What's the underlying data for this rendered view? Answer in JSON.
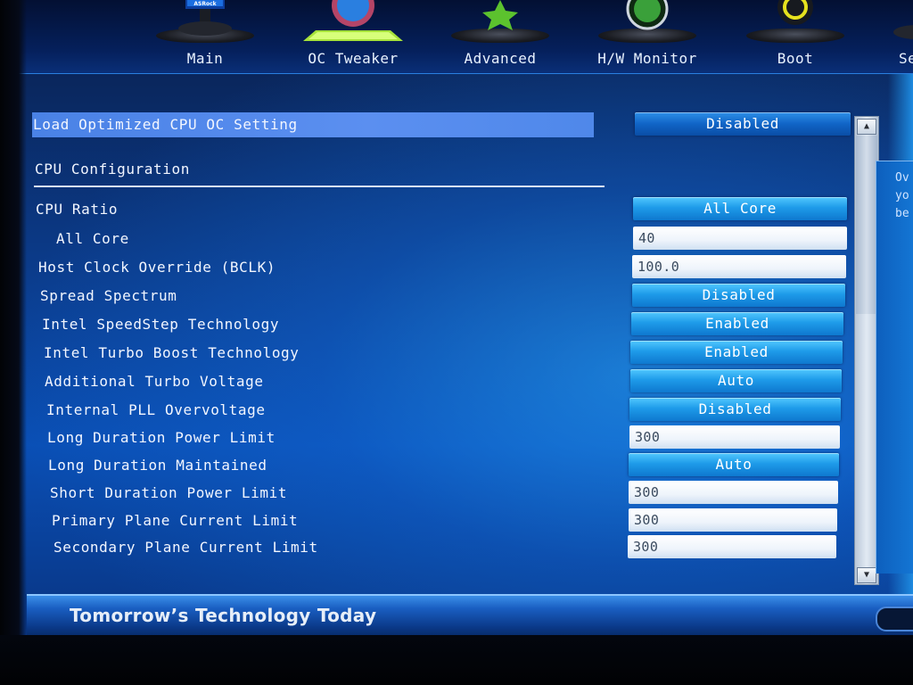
{
  "nav": {
    "tabs": [
      {
        "label": "Main",
        "icon": "monitor-icon",
        "brand_text": "ASRock"
      },
      {
        "label": "OC Tweaker",
        "icon": "gauge-icon"
      },
      {
        "label": "Advanced",
        "icon": "star-icon"
      },
      {
        "label": "H/W Monitor",
        "icon": "radar-icon"
      },
      {
        "label": "Boot",
        "icon": "power-icon"
      },
      {
        "label": "Se",
        "icon": "lock-icon"
      }
    ],
    "active_tab": "OC Tweaker"
  },
  "settings": {
    "load_optimized": {
      "label": "Load Optimized CPU OC Setting",
      "value": "Disabled"
    },
    "section_title": "CPU Configuration",
    "rows": [
      {
        "label": "CPU Ratio",
        "value": "All Core",
        "type": "select"
      },
      {
        "label": "All Core",
        "value": "40",
        "type": "input"
      },
      {
        "label": "Host Clock Override (BCLK)",
        "value": "100.0",
        "type": "input"
      },
      {
        "label": "Spread Spectrum",
        "value": "Disabled",
        "type": "select"
      },
      {
        "label": "Intel SpeedStep Technology",
        "value": "Enabled",
        "type": "select"
      },
      {
        "label": "Intel Turbo Boost Technology",
        "value": "Enabled",
        "type": "select"
      },
      {
        "label": "Additional Turbo Voltage",
        "value": "Auto",
        "type": "select"
      },
      {
        "label": "Internal PLL Overvoltage",
        "value": "Disabled",
        "type": "select"
      },
      {
        "label": "Long Duration Power Limit",
        "value": "300",
        "type": "input"
      },
      {
        "label": "Long Duration Maintained",
        "value": "Auto",
        "type": "select"
      },
      {
        "label": "Short Duration Power Limit",
        "value": "300",
        "type": "input"
      },
      {
        "label": "Primary Plane Current Limit",
        "value": "300",
        "type": "input"
      },
      {
        "label": "Secondary Plane Current Limit",
        "value": "300",
        "type": "input"
      }
    ]
  },
  "help": {
    "lines": [
      "Ov",
      "yo",
      "be"
    ]
  },
  "footer": {
    "slogan": "Tomorrow’s Technology Today"
  },
  "colors": {
    "accent": "#1e9be9",
    "highlight": "#5b8ff0",
    "background": "#0a4fb5"
  }
}
